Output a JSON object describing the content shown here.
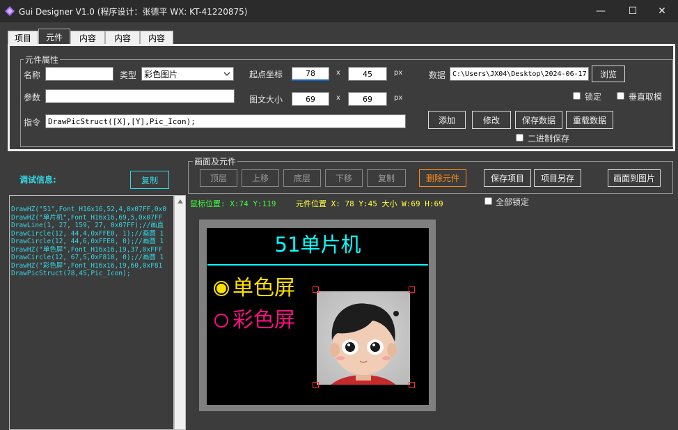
{
  "window": {
    "title": "Gui Designer V1.0 (程序设计：张德平 WX: KT-41220875)",
    "minimize_glyph": "—",
    "maximize_glyph": "☐",
    "close_glyph": "✕"
  },
  "tabs": [
    {
      "label": "项目"
    },
    {
      "label": "元件"
    },
    {
      "label": "内容"
    },
    {
      "label": "内容"
    },
    {
      "label": "内容"
    }
  ],
  "props": {
    "group_title": "元件属性",
    "name_label": "名称",
    "name_value": "",
    "type_label": "类型",
    "type_value": "彩色图片",
    "param_label": "参数",
    "param_value": "",
    "cmd_label": "指令",
    "cmd_value": "DrawPicStruct([X],[Y],Pic_Icon);",
    "origin_label": "起点坐标",
    "origin_x": "78",
    "origin_y": "45",
    "size_label": "图文大小",
    "size_w": "69",
    "size_h": "69",
    "times": "x",
    "unit": "px",
    "data_label": "数据",
    "data_value": "C:\\Users\\JX04\\Desktop\\2024-06-17.",
    "browse": "浏览",
    "lock": "锁定",
    "vertical": "垂直取模",
    "add": "添加",
    "modify": "修改",
    "save_data": "保存数据",
    "reload_data": "重载数据",
    "binary_save": "二进制保存"
  },
  "debug": {
    "label": "调试信息:",
    "copy": "复制",
    "lines": [
      "DrawHZ(\"51\",Font_H16x16,52,4,0x07FF,0x0",
      "DrawHZ(\"单片机\",Font_H16x16,69,5,0x07FF",
      "DrawLine(1, 27, 159, 27, 0x07FF);//画直",
      "DrawCircle(12, 44,4,0xFFE0, 1);//画圆 1",
      "DrawCircle(12, 44,6,0xFFE0, 0);//画圆 1",
      "DrawHZ(\"单色屏\",Font_H16x16,19,37,0xFFF",
      "DrawCircle(12, 67,5,0xF810, 0);//画圆 1",
      "DrawHZ(\"彩色屏\",Font_H16x16,19,60,0xF81",
      "DrawPicStruct(78,45,Pic_Icon);"
    ]
  },
  "screen": {
    "group_title": "画面及元件",
    "top_layer": "顶层",
    "move_up": "上移",
    "bottom_layer": "底层",
    "move_down": "下移",
    "copy": "复制",
    "delete": "删除元件",
    "save_project": "保存项目",
    "save_as": "项目另存",
    "to_image": "画面到图片",
    "mouse_pos": "鼠标位置:  X:74 Y:119",
    "elem_pos": "元件位置 X: 78 Y:45 大小 W:69 H:69",
    "lock_all": "全部锁定"
  },
  "canvas": {
    "title": "51单片机",
    "mono_label": "单色屏",
    "color_label": "彩色屏",
    "colors": {
      "cyan": "#07FFFF",
      "yellow": "#FFE000",
      "magenta": "#F81080"
    }
  }
}
